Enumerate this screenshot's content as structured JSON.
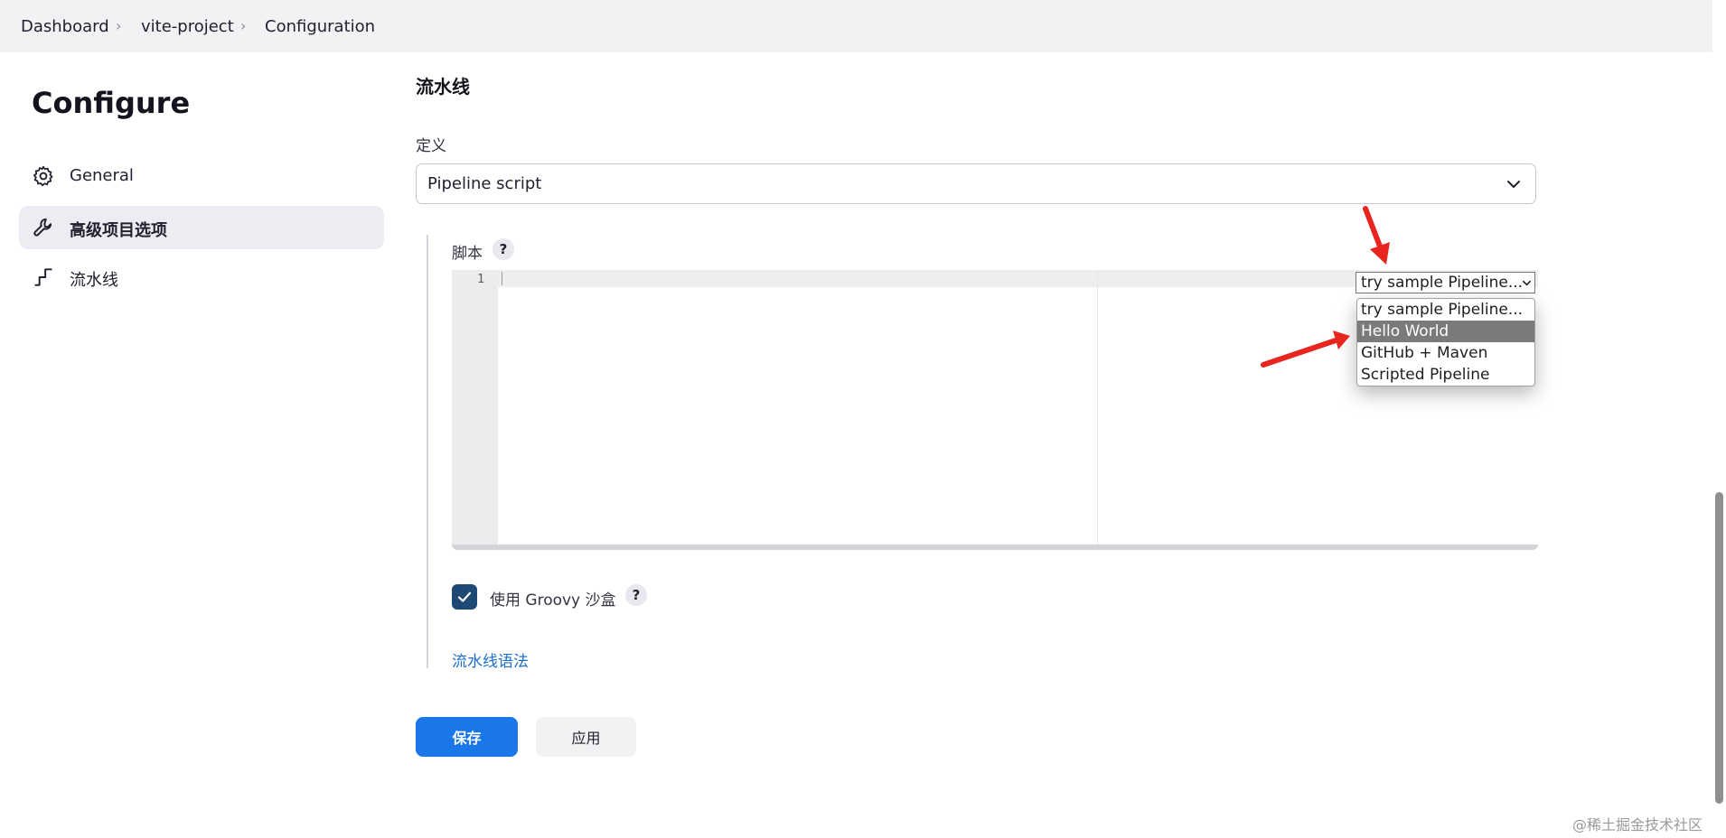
{
  "breadcrumb": {
    "items": [
      "Dashboard",
      "vite-project",
      "Configuration"
    ]
  },
  "sidebar": {
    "title": "Configure",
    "items": [
      {
        "label": "General",
        "icon": "gear-icon",
        "active": false
      },
      {
        "label": "高级项目选项",
        "icon": "wrench-icon",
        "active": true
      },
      {
        "label": "流水线",
        "icon": "pipeline-icon",
        "active": false
      }
    ]
  },
  "pipeline": {
    "section_title": "流水线",
    "definition_label": "定义",
    "definition_value": "Pipeline script",
    "script_label": "脚本",
    "help_label": "?",
    "editor": {
      "line_numbers": [
        "1"
      ]
    },
    "sample_select": {
      "selected": "try sample Pipeline...",
      "options": [
        "try sample Pipeline...",
        "Hello World",
        "GitHub + Maven",
        "Scripted Pipeline"
      ],
      "highlighted_index": 1
    },
    "sandbox": {
      "label": "使用 Groovy 沙盒",
      "checked": true
    },
    "syntax_link": "流水线语法"
  },
  "buttons": {
    "save": "保存",
    "apply": "应用"
  },
  "watermark": "@稀土掘金技术社区",
  "colors": {
    "primary": "#1977ea",
    "link": "#1e6fce",
    "checkbox": "#1c4a75",
    "annotation_arrow": "#e8251f",
    "breadcrumb_bg": "#f2f2f5",
    "active_nav_bg": "#ececf2"
  }
}
